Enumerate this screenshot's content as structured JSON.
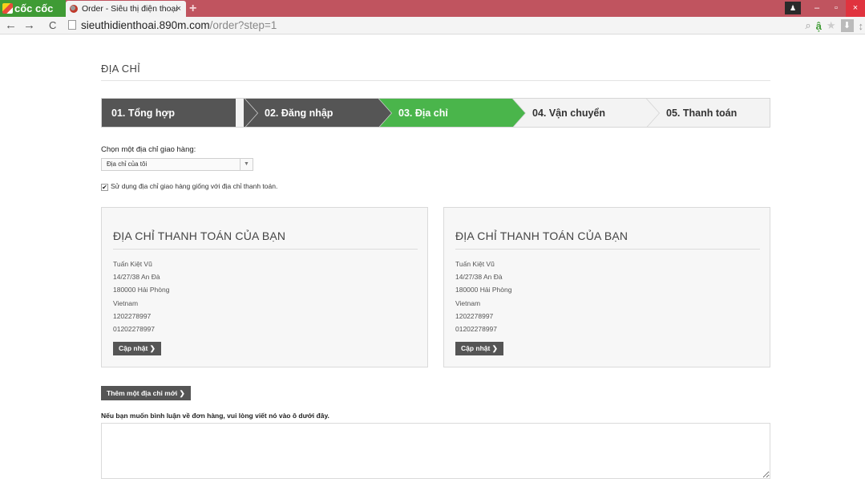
{
  "browser": {
    "brand": "cốc cốc",
    "tab_title": "Order - Siêu thị điện thoại",
    "tab_close": "×",
    "new_tab": "+",
    "url_host": "sieuthidienthoai.890m.com",
    "url_path": "/order?step=1",
    "back": "←",
    "forward": "→",
    "reload": "C",
    "win_min": "–",
    "win_max": "▫",
    "win_close": "×",
    "user": "♟",
    "zoom": "⌕",
    "star": "★",
    "download": "⬇",
    "extra": "↕",
    "ext": "ậ"
  },
  "page": {
    "title": "ĐỊA CHỈ",
    "steps": [
      {
        "label": "01. Tổng hợp",
        "state": "done"
      },
      {
        "label": "02. Đăng nhập",
        "state": "done"
      },
      {
        "label": "03. Địa chỉ",
        "state": "active"
      },
      {
        "label": "04. Vận chuyển",
        "state": "todo"
      },
      {
        "label": "05. Thanh toán",
        "state": "todo"
      }
    ],
    "choose_label": "Chọn một địa chỉ giao hàng:",
    "select_value": "Địa chỉ của tôi",
    "select_caret": "▼",
    "checkbox_mark": "✔",
    "same_address": "Sử dụng địa chỉ giao hàng giống với địa chỉ thanh toán.",
    "cards": [
      {
        "heading": "ĐỊA CHỈ THANH TOÁN CỦA BẠN",
        "lines": [
          "Tuấn Kiệt Vũ",
          "14/27/38 An Đà",
          "180000 Hải Phòng",
          "Vietnam",
          "1202278997",
          "01202278997"
        ],
        "button": "Cập nhật ❯"
      },
      {
        "heading": "ĐỊA CHỈ THANH TOÁN CỦA BẠN",
        "lines": [
          "Tuấn Kiệt Vũ",
          "14/27/38 An Đà",
          "180000 Hải Phòng",
          "Vietnam",
          "1202278997",
          "01202278997"
        ],
        "button": "Cập nhật ❯"
      }
    ],
    "add_new": "Thêm một địa chỉ mới ❯",
    "comment_label": "Nếu bạn muốn bình luận về đơn hàng, vui lòng viết nó vào ô dưới đây.",
    "comment_value": ""
  },
  "colors": {
    "titlebar": "#c0545f",
    "brand": "#3f9b35",
    "step_done": "#555555",
    "step_active": "#4ab54b",
    "step_todo": "#f3f3f3"
  }
}
